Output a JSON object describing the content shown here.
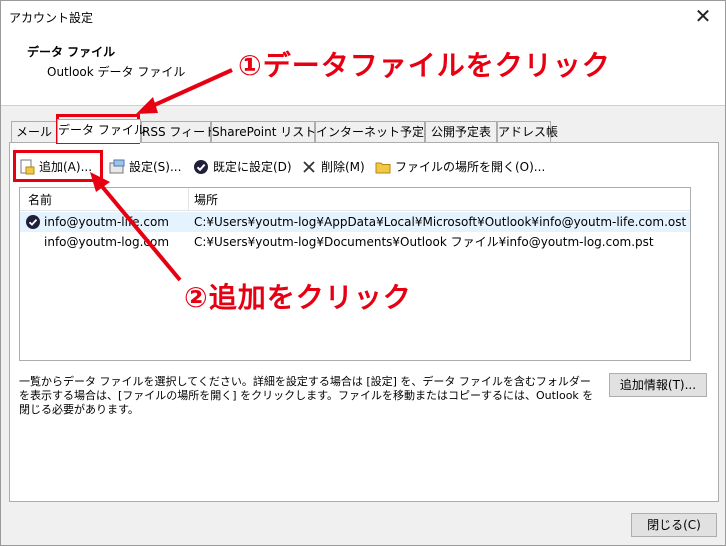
{
  "window": {
    "title": "アカウント設定",
    "close_glyph": "✕"
  },
  "header": {
    "title": "データ ファイル",
    "subtitle": "Outlook データ ファイル"
  },
  "tabs": [
    {
      "label": "メール"
    },
    {
      "label": "データ ファイル"
    },
    {
      "label": "RSS フィード"
    },
    {
      "label": "SharePoint リスト"
    },
    {
      "label": "インターネット予定表"
    },
    {
      "label": "公開予定表"
    },
    {
      "label": "アドレス帳"
    }
  ],
  "toolbar": {
    "add": "追加(A)...",
    "settings": "設定(S)...",
    "default": "既定に設定(D)",
    "delete": "削除(M)",
    "open_location": "ファイルの場所を開く(O)..."
  },
  "table": {
    "columns": [
      "名前",
      "場所"
    ],
    "rows": [
      {
        "name": "info@youtm-life.com",
        "location": "C:¥Users¥youtm-log¥AppData¥Local¥Microsoft¥Outlook¥info@youtm-life.com.ost",
        "is_default": true
      },
      {
        "name": "info@youtm-log.com",
        "location": "C:¥Users¥youtm-log¥Documents¥Outlook ファイル¥info@youtm-log.com.pst",
        "is_default": false
      }
    ]
  },
  "description": "一覧からデータ ファイルを選択してください。詳細を設定する場合は [設定] を、データ ファイルを含むフォルダーを表示する場合は、[ファイルの場所を開く] をクリックします。ファイルを移動またはコピーするには、Outlook を閉じる必要があります。",
  "buttons": {
    "more_info": "追加情報(T)...",
    "close": "閉じる(C)"
  },
  "annotations": {
    "step1": "①データファイルをクリック",
    "step2": "②追加をクリック",
    "color": "#e60012"
  }
}
